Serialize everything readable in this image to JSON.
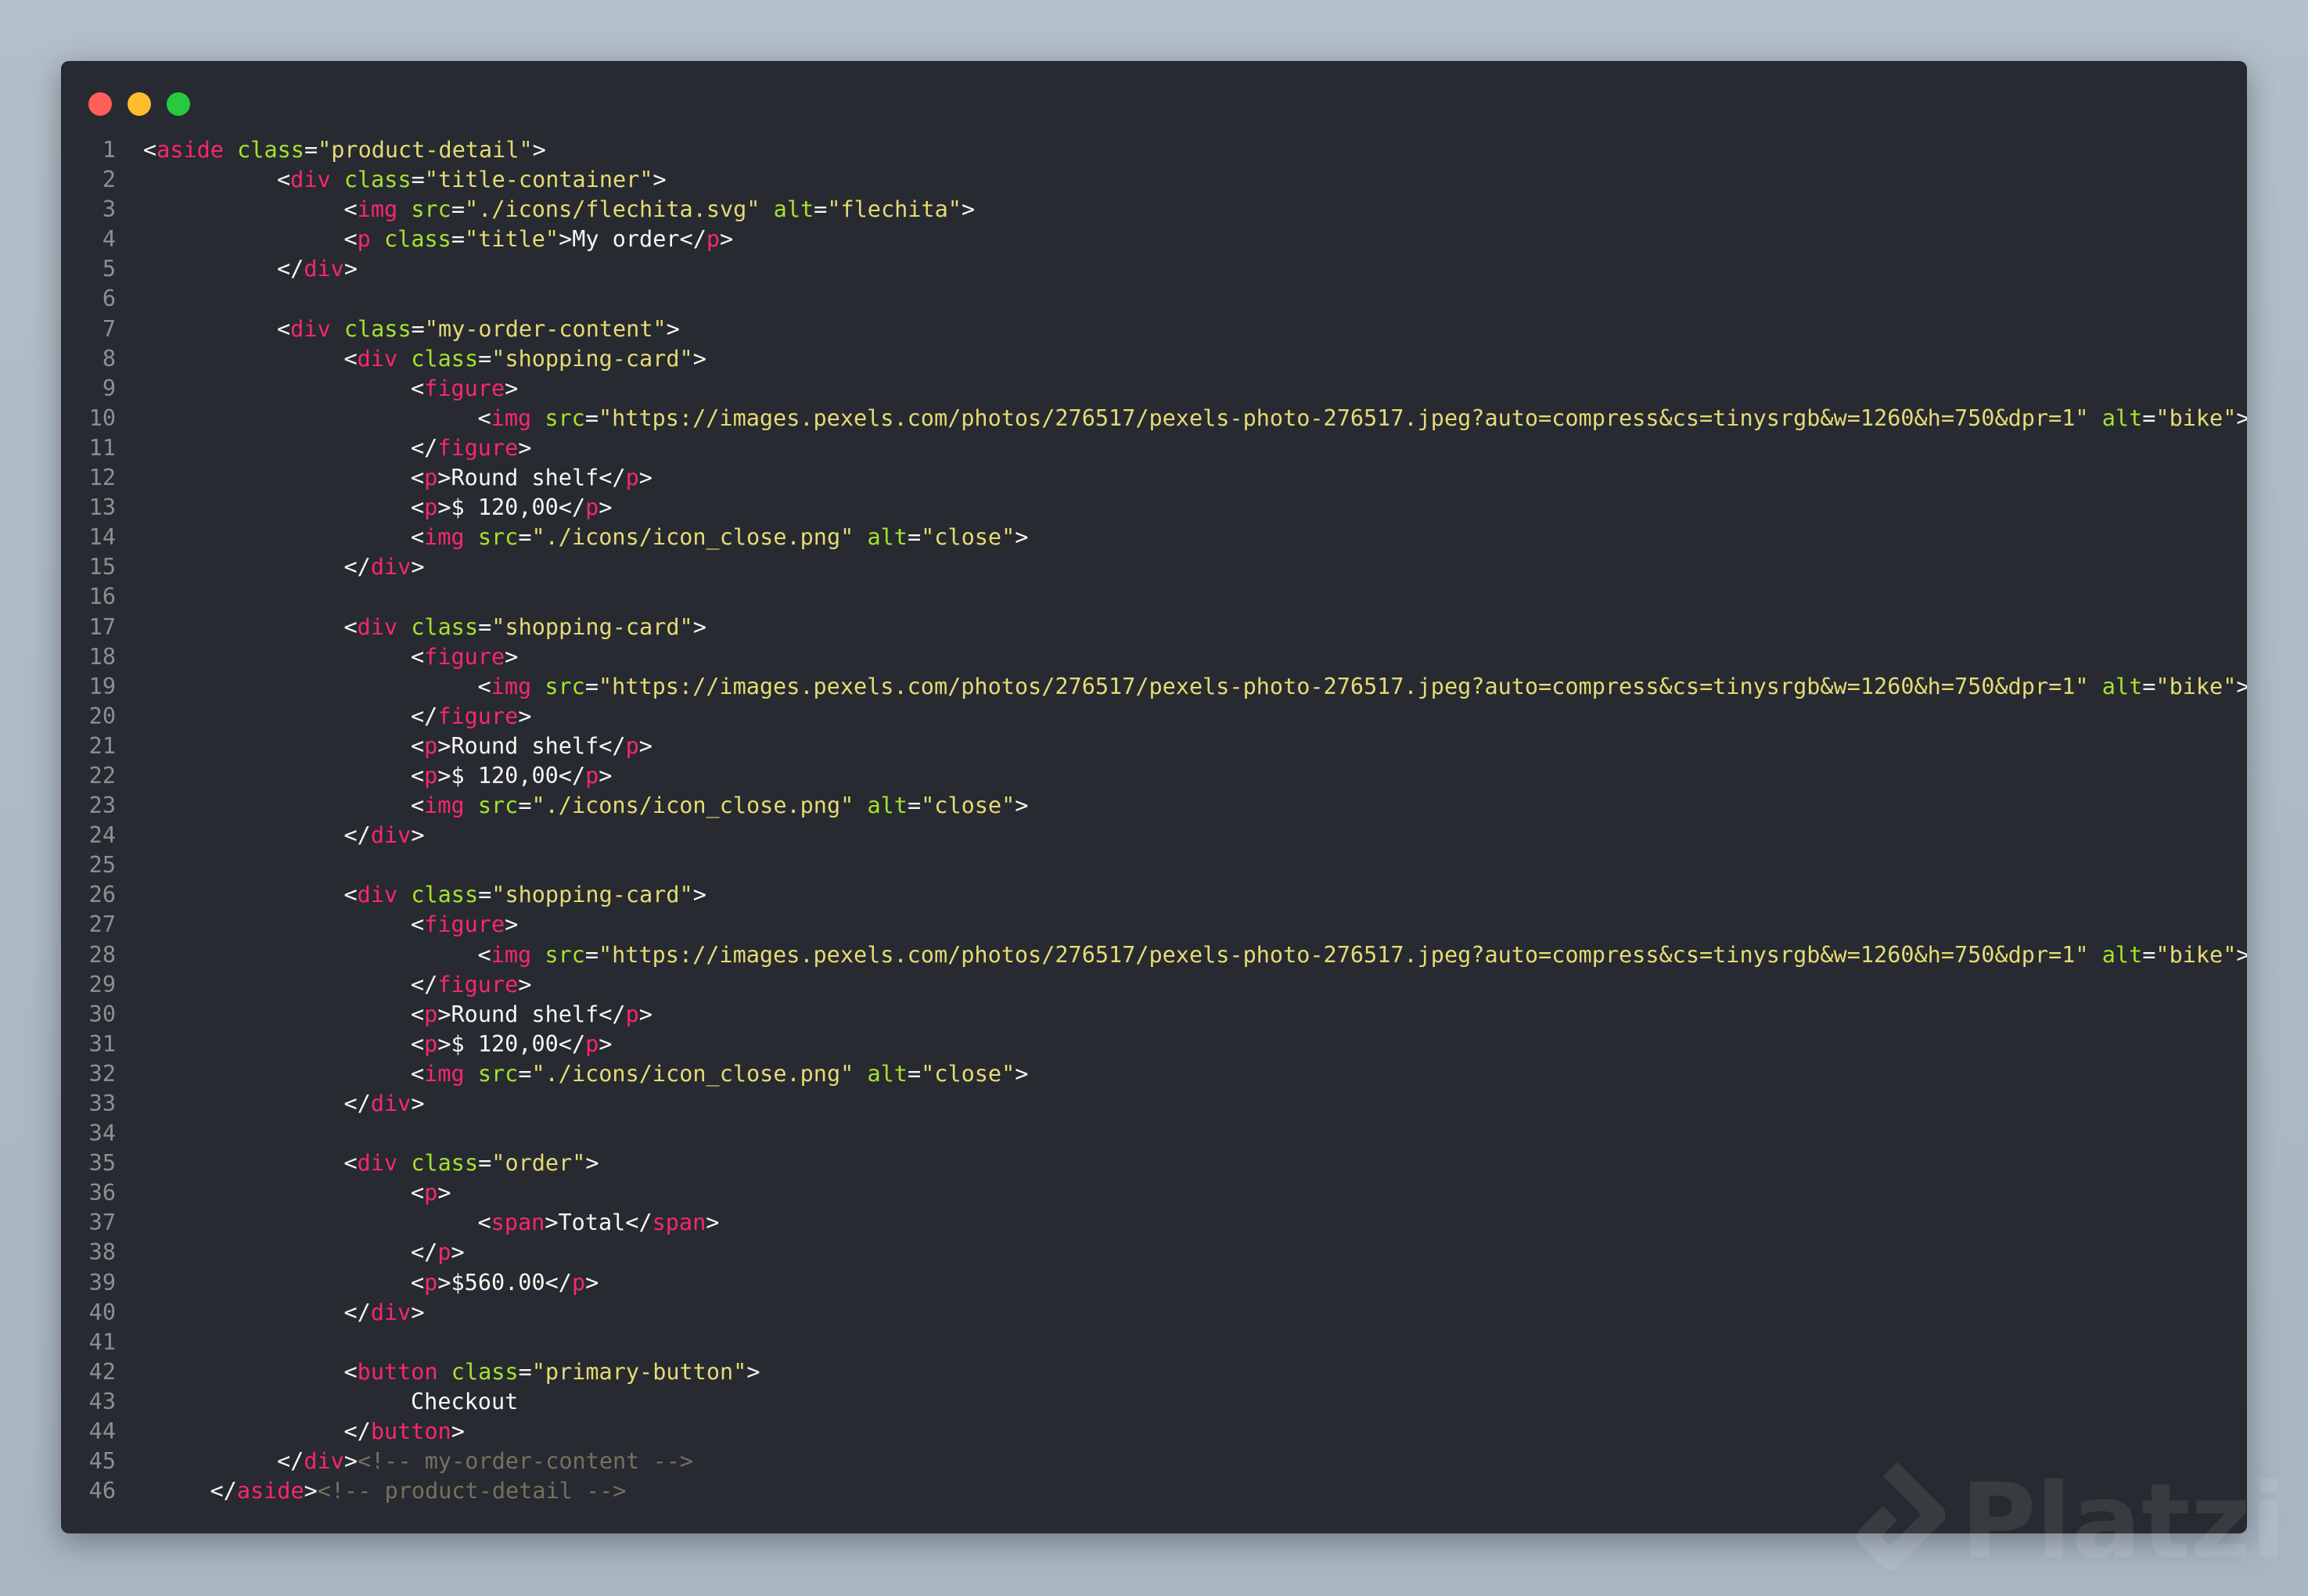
{
  "window": {
    "controls": [
      {
        "name": "close",
        "color": "#ff5f56"
      },
      {
        "name": "minimize",
        "color": "#ffbd2e"
      },
      {
        "name": "zoom",
        "color": "#27c93f"
      }
    ]
  },
  "colors": {
    "background": "#272a30",
    "punctuation": "#f8f8f2",
    "tag": "#f92672",
    "attribute": "#a6e22e",
    "string": "#e6db74",
    "comment": "#75715e",
    "line_number": "#8c8f94"
  },
  "watermark": {
    "text": "Platzi",
    "icon": "platzi-logo-icon"
  },
  "code_lines": [
    {
      "n": "1",
      "indent": 0,
      "tokens": [
        [
          "p",
          "<"
        ],
        [
          "t",
          "aside"
        ],
        [
          "p",
          " "
        ],
        [
          "a",
          "class"
        ],
        [
          "p",
          "="
        ],
        [
          "s",
          "\"product-detail\""
        ],
        [
          "p",
          ">"
        ]
      ]
    },
    {
      "n": "2",
      "indent": 10,
      "tokens": [
        [
          "p",
          "<"
        ],
        [
          "t",
          "div"
        ],
        [
          "p",
          " "
        ],
        [
          "a",
          "class"
        ],
        [
          "p",
          "="
        ],
        [
          "s",
          "\"title-container\""
        ],
        [
          "p",
          ">"
        ]
      ]
    },
    {
      "n": "3",
      "indent": 15,
      "tokens": [
        [
          "p",
          "<"
        ],
        [
          "t",
          "img"
        ],
        [
          "p",
          " "
        ],
        [
          "a",
          "src"
        ],
        [
          "p",
          "="
        ],
        [
          "s",
          "\"./icons/flechita.svg\""
        ],
        [
          "p",
          " "
        ],
        [
          "a",
          "alt"
        ],
        [
          "p",
          "="
        ],
        [
          "s",
          "\"flechita\""
        ],
        [
          "p",
          ">"
        ]
      ]
    },
    {
      "n": "4",
      "indent": 15,
      "tokens": [
        [
          "p",
          "<"
        ],
        [
          "t",
          "p"
        ],
        [
          "p",
          " "
        ],
        [
          "a",
          "class"
        ],
        [
          "p",
          "="
        ],
        [
          "s",
          "\"title\""
        ],
        [
          "p",
          ">"
        ],
        [
          "x",
          "My order"
        ],
        [
          "p",
          "</"
        ],
        [
          "t",
          "p"
        ],
        [
          "p",
          ">"
        ]
      ]
    },
    {
      "n": "5",
      "indent": 10,
      "tokens": [
        [
          "p",
          "</"
        ],
        [
          "t",
          "div"
        ],
        [
          "p",
          ">"
        ]
      ]
    },
    {
      "n": "6",
      "indent": 0,
      "tokens": []
    },
    {
      "n": "7",
      "indent": 10,
      "tokens": [
        [
          "p",
          "<"
        ],
        [
          "t",
          "div"
        ],
        [
          "p",
          " "
        ],
        [
          "a",
          "class"
        ],
        [
          "p",
          "="
        ],
        [
          "s",
          "\"my-order-content\""
        ],
        [
          "p",
          ">"
        ]
      ]
    },
    {
      "n": "8",
      "indent": 15,
      "tokens": [
        [
          "p",
          "<"
        ],
        [
          "t",
          "div"
        ],
        [
          "p",
          " "
        ],
        [
          "a",
          "class"
        ],
        [
          "p",
          "="
        ],
        [
          "s",
          "\"shopping-card\""
        ],
        [
          "p",
          ">"
        ]
      ]
    },
    {
      "n": "9",
      "indent": 20,
      "tokens": [
        [
          "p",
          "<"
        ],
        [
          "t",
          "figure"
        ],
        [
          "p",
          ">"
        ]
      ]
    },
    {
      "n": "10",
      "indent": 25,
      "tokens": [
        [
          "p",
          "<"
        ],
        [
          "t",
          "img"
        ],
        [
          "p",
          " "
        ],
        [
          "a",
          "src"
        ],
        [
          "p",
          "="
        ],
        [
          "s",
          "\"https://images.pexels.com/photos/276517/pexels-photo-276517.jpeg?auto=compress&cs=tinysrgb&w=1260&h=750&dpr=1\""
        ],
        [
          "p",
          " "
        ],
        [
          "a",
          "alt"
        ],
        [
          "p",
          "="
        ],
        [
          "s",
          "\"bike\""
        ],
        [
          "p",
          ">"
        ]
      ]
    },
    {
      "n": "11",
      "indent": 20,
      "tokens": [
        [
          "p",
          "</"
        ],
        [
          "t",
          "figure"
        ],
        [
          "p",
          ">"
        ]
      ]
    },
    {
      "n": "12",
      "indent": 20,
      "tokens": [
        [
          "p",
          "<"
        ],
        [
          "t",
          "p"
        ],
        [
          "p",
          ">"
        ],
        [
          "x",
          "Round shelf"
        ],
        [
          "p",
          "</"
        ],
        [
          "t",
          "p"
        ],
        [
          "p",
          ">"
        ]
      ]
    },
    {
      "n": "13",
      "indent": 20,
      "tokens": [
        [
          "p",
          "<"
        ],
        [
          "t",
          "p"
        ],
        [
          "p",
          ">"
        ],
        [
          "x",
          "$ 120,00"
        ],
        [
          "p",
          "</"
        ],
        [
          "t",
          "p"
        ],
        [
          "p",
          ">"
        ]
      ]
    },
    {
      "n": "14",
      "indent": 20,
      "tokens": [
        [
          "p",
          "<"
        ],
        [
          "t",
          "img"
        ],
        [
          "p",
          " "
        ],
        [
          "a",
          "src"
        ],
        [
          "p",
          "="
        ],
        [
          "s",
          "\"./icons/icon_close.png\""
        ],
        [
          "p",
          " "
        ],
        [
          "a",
          "alt"
        ],
        [
          "p",
          "="
        ],
        [
          "s",
          "\"close\""
        ],
        [
          "p",
          ">"
        ]
      ]
    },
    {
      "n": "15",
      "indent": 15,
      "tokens": [
        [
          "p",
          "</"
        ],
        [
          "t",
          "div"
        ],
        [
          "p",
          ">"
        ]
      ]
    },
    {
      "n": "16",
      "indent": 0,
      "tokens": []
    },
    {
      "n": "17",
      "indent": 15,
      "tokens": [
        [
          "p",
          "<"
        ],
        [
          "t",
          "div"
        ],
        [
          "p",
          " "
        ],
        [
          "a",
          "class"
        ],
        [
          "p",
          "="
        ],
        [
          "s",
          "\"shopping-card\""
        ],
        [
          "p",
          ">"
        ]
      ]
    },
    {
      "n": "18",
      "indent": 20,
      "tokens": [
        [
          "p",
          "<"
        ],
        [
          "t",
          "figure"
        ],
        [
          "p",
          ">"
        ]
      ]
    },
    {
      "n": "19",
      "indent": 25,
      "tokens": [
        [
          "p",
          "<"
        ],
        [
          "t",
          "img"
        ],
        [
          "p",
          " "
        ],
        [
          "a",
          "src"
        ],
        [
          "p",
          "="
        ],
        [
          "s",
          "\"https://images.pexels.com/photos/276517/pexels-photo-276517.jpeg?auto=compress&cs=tinysrgb&w=1260&h=750&dpr=1\""
        ],
        [
          "p",
          " "
        ],
        [
          "a",
          "alt"
        ],
        [
          "p",
          "="
        ],
        [
          "s",
          "\"bike\""
        ],
        [
          "p",
          ">"
        ]
      ]
    },
    {
      "n": "20",
      "indent": 20,
      "tokens": [
        [
          "p",
          "</"
        ],
        [
          "t",
          "figure"
        ],
        [
          "p",
          ">"
        ]
      ]
    },
    {
      "n": "21",
      "indent": 20,
      "tokens": [
        [
          "p",
          "<"
        ],
        [
          "t",
          "p"
        ],
        [
          "p",
          ">"
        ],
        [
          "x",
          "Round shelf"
        ],
        [
          "p",
          "</"
        ],
        [
          "t",
          "p"
        ],
        [
          "p",
          ">"
        ]
      ]
    },
    {
      "n": "22",
      "indent": 20,
      "tokens": [
        [
          "p",
          "<"
        ],
        [
          "t",
          "p"
        ],
        [
          "p",
          ">"
        ],
        [
          "x",
          "$ 120,00"
        ],
        [
          "p",
          "</"
        ],
        [
          "t",
          "p"
        ],
        [
          "p",
          ">"
        ]
      ]
    },
    {
      "n": "23",
      "indent": 20,
      "tokens": [
        [
          "p",
          "<"
        ],
        [
          "t",
          "img"
        ],
        [
          "p",
          " "
        ],
        [
          "a",
          "src"
        ],
        [
          "p",
          "="
        ],
        [
          "s",
          "\"./icons/icon_close.png\""
        ],
        [
          "p",
          " "
        ],
        [
          "a",
          "alt"
        ],
        [
          "p",
          "="
        ],
        [
          "s",
          "\"close\""
        ],
        [
          "p",
          ">"
        ]
      ]
    },
    {
      "n": "24",
      "indent": 15,
      "tokens": [
        [
          "p",
          "</"
        ],
        [
          "t",
          "div"
        ],
        [
          "p",
          ">"
        ]
      ]
    },
    {
      "n": "25",
      "indent": 0,
      "tokens": []
    },
    {
      "n": "26",
      "indent": 15,
      "tokens": [
        [
          "p",
          "<"
        ],
        [
          "t",
          "div"
        ],
        [
          "p",
          " "
        ],
        [
          "a",
          "class"
        ],
        [
          "p",
          "="
        ],
        [
          "s",
          "\"shopping-card\""
        ],
        [
          "p",
          ">"
        ]
      ]
    },
    {
      "n": "27",
      "indent": 20,
      "tokens": [
        [
          "p",
          "<"
        ],
        [
          "t",
          "figure"
        ],
        [
          "p",
          ">"
        ]
      ]
    },
    {
      "n": "28",
      "indent": 25,
      "tokens": [
        [
          "p",
          "<"
        ],
        [
          "t",
          "img"
        ],
        [
          "p",
          " "
        ],
        [
          "a",
          "src"
        ],
        [
          "p",
          "="
        ],
        [
          "s",
          "\"https://images.pexels.com/photos/276517/pexels-photo-276517.jpeg?auto=compress&cs=tinysrgb&w=1260&h=750&dpr=1\""
        ],
        [
          "p",
          " "
        ],
        [
          "a",
          "alt"
        ],
        [
          "p",
          "="
        ],
        [
          "s",
          "\"bike\""
        ],
        [
          "p",
          ">"
        ]
      ]
    },
    {
      "n": "29",
      "indent": 20,
      "tokens": [
        [
          "p",
          "</"
        ],
        [
          "t",
          "figure"
        ],
        [
          "p",
          ">"
        ]
      ]
    },
    {
      "n": "30",
      "indent": 20,
      "tokens": [
        [
          "p",
          "<"
        ],
        [
          "t",
          "p"
        ],
        [
          "p",
          ">"
        ],
        [
          "x",
          "Round shelf"
        ],
        [
          "p",
          "</"
        ],
        [
          "t",
          "p"
        ],
        [
          "p",
          ">"
        ]
      ]
    },
    {
      "n": "31",
      "indent": 20,
      "tokens": [
        [
          "p",
          "<"
        ],
        [
          "t",
          "p"
        ],
        [
          "p",
          ">"
        ],
        [
          "x",
          "$ 120,00"
        ],
        [
          "p",
          "</"
        ],
        [
          "t",
          "p"
        ],
        [
          "p",
          ">"
        ]
      ]
    },
    {
      "n": "32",
      "indent": 20,
      "tokens": [
        [
          "p",
          "<"
        ],
        [
          "t",
          "img"
        ],
        [
          "p",
          " "
        ],
        [
          "a",
          "src"
        ],
        [
          "p",
          "="
        ],
        [
          "s",
          "\"./icons/icon_close.png\""
        ],
        [
          "p",
          " "
        ],
        [
          "a",
          "alt"
        ],
        [
          "p",
          "="
        ],
        [
          "s",
          "\"close\""
        ],
        [
          "p",
          ">"
        ]
      ]
    },
    {
      "n": "33",
      "indent": 15,
      "tokens": [
        [
          "p",
          "</"
        ],
        [
          "t",
          "div"
        ],
        [
          "p",
          ">"
        ]
      ]
    },
    {
      "n": "34",
      "indent": 0,
      "tokens": []
    },
    {
      "n": "35",
      "indent": 15,
      "tokens": [
        [
          "p",
          "<"
        ],
        [
          "t",
          "div"
        ],
        [
          "p",
          " "
        ],
        [
          "a",
          "class"
        ],
        [
          "p",
          "="
        ],
        [
          "s",
          "\"order\""
        ],
        [
          "p",
          ">"
        ]
      ]
    },
    {
      "n": "36",
      "indent": 20,
      "tokens": [
        [
          "p",
          "<"
        ],
        [
          "t",
          "p"
        ],
        [
          "p",
          ">"
        ]
      ]
    },
    {
      "n": "37",
      "indent": 25,
      "tokens": [
        [
          "p",
          "<"
        ],
        [
          "t",
          "span"
        ],
        [
          "p",
          ">"
        ],
        [
          "x",
          "Total"
        ],
        [
          "p",
          "</"
        ],
        [
          "t",
          "span"
        ],
        [
          "p",
          ">"
        ]
      ]
    },
    {
      "n": "38",
      "indent": 20,
      "tokens": [
        [
          "p",
          "</"
        ],
        [
          "t",
          "p"
        ],
        [
          "p",
          ">"
        ]
      ]
    },
    {
      "n": "39",
      "indent": 20,
      "tokens": [
        [
          "p",
          "<"
        ],
        [
          "t",
          "p"
        ],
        [
          "p",
          ">"
        ],
        [
          "x",
          "$560.00"
        ],
        [
          "p",
          "</"
        ],
        [
          "t",
          "p"
        ],
        [
          "p",
          ">"
        ]
      ]
    },
    {
      "n": "40",
      "indent": 15,
      "tokens": [
        [
          "p",
          "</"
        ],
        [
          "t",
          "div"
        ],
        [
          "p",
          ">"
        ]
      ]
    },
    {
      "n": "41",
      "indent": 0,
      "tokens": []
    },
    {
      "n": "42",
      "indent": 15,
      "tokens": [
        [
          "p",
          "<"
        ],
        [
          "t",
          "button"
        ],
        [
          "p",
          " "
        ],
        [
          "a",
          "class"
        ],
        [
          "p",
          "="
        ],
        [
          "s",
          "\"primary-button\""
        ],
        [
          "p",
          ">"
        ]
      ]
    },
    {
      "n": "43",
      "indent": 20,
      "tokens": [
        [
          "x",
          "Checkout"
        ]
      ]
    },
    {
      "n": "44",
      "indent": 15,
      "tokens": [
        [
          "p",
          "</"
        ],
        [
          "t",
          "button"
        ],
        [
          "p",
          ">"
        ]
      ]
    },
    {
      "n": "45",
      "indent": 10,
      "tokens": [
        [
          "p",
          "</"
        ],
        [
          "t",
          "div"
        ],
        [
          "p",
          ">"
        ],
        [
          "c",
          "<!-- my-order-content -->"
        ]
      ]
    },
    {
      "n": "46",
      "indent": 5,
      "tokens": [
        [
          "p",
          "</"
        ],
        [
          "t",
          "aside"
        ],
        [
          "p",
          ">"
        ],
        [
          "c",
          "<!-- product-detail -->"
        ]
      ]
    }
  ]
}
